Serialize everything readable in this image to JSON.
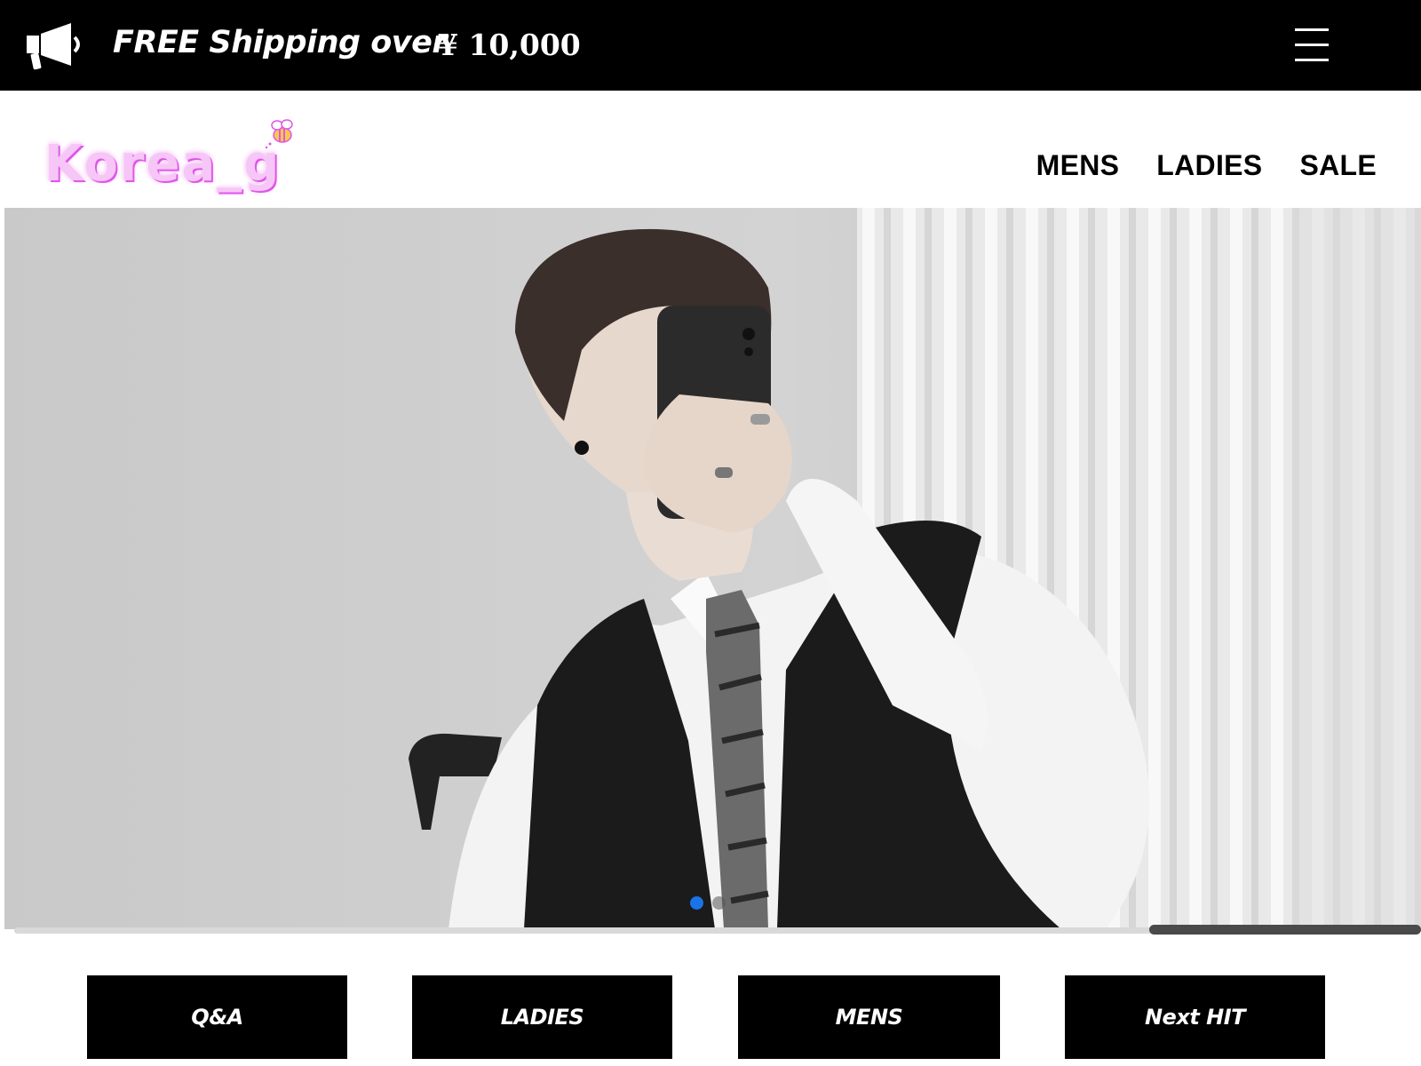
{
  "announcement": {
    "icon": "megaphone-icon",
    "text": "FREE Shipping over",
    "amount": "¥ 10,000"
  },
  "menu": {
    "icon": "hamburger-menu-icon"
  },
  "header": {
    "logo_text": "Korea_g",
    "logo_colors": {
      "fill": "#f6c6f7",
      "shadow": "#e056ea"
    },
    "nav": [
      {
        "label": "MENS"
      },
      {
        "label": "LADIES"
      },
      {
        "label": "SALE"
      }
    ]
  },
  "hero": {
    "image": "hero-slide-photo",
    "slides_total": 2,
    "active_slide": 1,
    "dot_active_color": "#1a73e8",
    "scroll_position_fraction": 0.82
  },
  "categories": [
    {
      "label": "Q&A"
    },
    {
      "label": "LADIES"
    },
    {
      "label": "MENS"
    },
    {
      "label": "Next HIT"
    }
  ]
}
